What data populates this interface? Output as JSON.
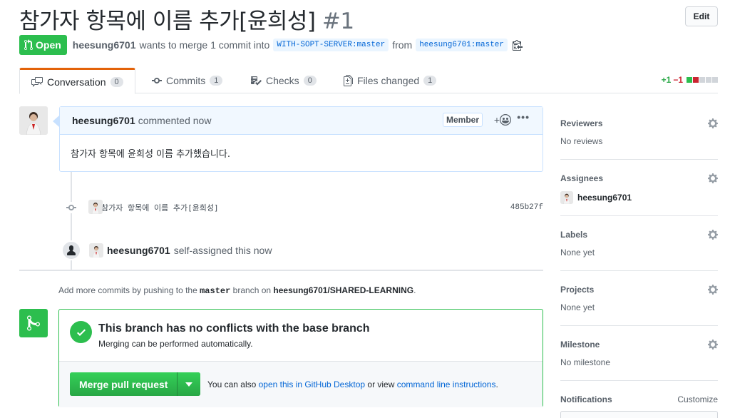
{
  "pr": {
    "title": "참가자 항목에 이름 추가[윤희성]",
    "number": "#1",
    "edit_label": "Edit",
    "state": "Open",
    "author": "heesung6701",
    "merge_text": "wants to merge 1 commit into",
    "base_branch": "WITH-SOPT-SERVER:master",
    "from_text": "from",
    "head_branch": "heesung6701:master"
  },
  "tabs": [
    {
      "label": "Conversation",
      "count": "0",
      "icon": "comment-discussion-icon"
    },
    {
      "label": "Commits",
      "count": "1",
      "icon": "commit-icon"
    },
    {
      "label": "Checks",
      "count": "0",
      "icon": "checklist-icon"
    },
    {
      "label": "Files changed",
      "count": "1",
      "icon": "file-diff-icon"
    }
  ],
  "diffstat": {
    "additions": "+1",
    "deletions": "−1"
  },
  "comment": {
    "author": "heesung6701",
    "time": "commented now",
    "badge": "Member",
    "reaction": "+",
    "body": "참가자 항목에 윤희성 이름 추가했습니다."
  },
  "commit": {
    "message": "참가자 항목에 이름 추가[윤희성]",
    "sha": "485b27f"
  },
  "event": {
    "actor": "heesung6701",
    "text": "self-assigned this now"
  },
  "push_hint": {
    "prefix": "Add more commits by pushing to the",
    "branch": "master",
    "middle": "branch on",
    "repo": "heesung6701/SHARED-LEARNING",
    "suffix": "."
  },
  "merge": {
    "title": "This branch has no conflicts with the base branch",
    "subtitle": "Merging can be performed automatically.",
    "button": "Merge pull request",
    "note_prefix": "You can also",
    "link1": "open this in GitHub Desktop",
    "note_middle": "or view",
    "link2": "command line instructions",
    "note_suffix": "."
  },
  "sidebar": {
    "reviewers": {
      "label": "Reviewers",
      "value": "No reviews"
    },
    "assignees": {
      "label": "Assignees",
      "value": "heesung6701"
    },
    "labels": {
      "label": "Labels",
      "value": "None yet"
    },
    "projects": {
      "label": "Projects",
      "value": "None yet"
    },
    "milestone": {
      "label": "Milestone",
      "value": "No milestone"
    },
    "notifications": {
      "label": "Notifications",
      "action": "Customize"
    }
  },
  "colors": {
    "open_green": "#2cbe4e",
    "link_blue": "#0366d6",
    "tab_accent": "#e36209",
    "deletion_red": "#cb2431"
  }
}
